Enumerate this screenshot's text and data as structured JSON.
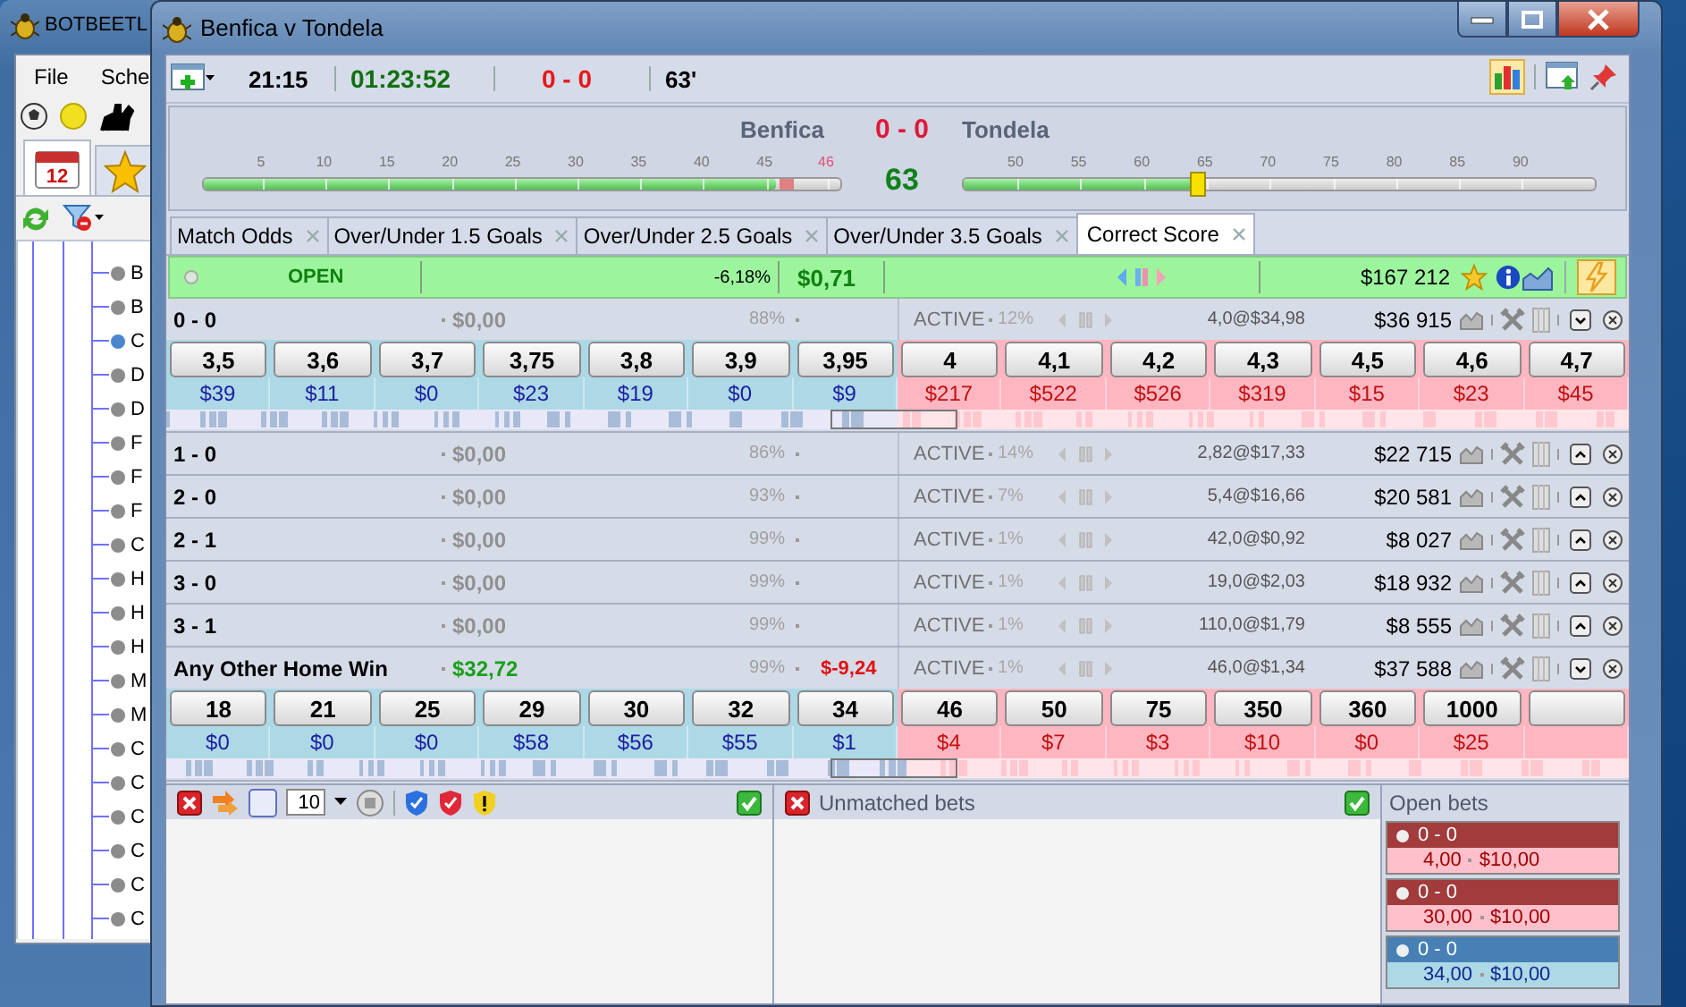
{
  "background_window": {
    "title": "BOTBEETL",
    "menu": [
      "File",
      "Sche"
    ],
    "calendar_day": "12",
    "tabs": [
      {
        "kind": "calendar",
        "selected": true
      },
      {
        "kind": "favorites",
        "selected": false
      }
    ],
    "tree_items": [
      {
        "label": "B",
        "color": "#8c8c8c"
      },
      {
        "label": "B",
        "color": "#8c8c8c"
      },
      {
        "label": "C",
        "color": "#4a86d0"
      },
      {
        "label": "D",
        "color": "#8c8c8c"
      },
      {
        "label": "D",
        "color": "#8c8c8c"
      },
      {
        "label": "F",
        "color": "#8c8c8c"
      },
      {
        "label": "F",
        "color": "#8c8c8c"
      },
      {
        "label": "F",
        "color": "#8c8c8c"
      },
      {
        "label": "C",
        "color": "#8c8c8c"
      },
      {
        "label": "H",
        "color": "#8c8c8c"
      },
      {
        "label": "H",
        "color": "#8c8c8c"
      },
      {
        "label": "H",
        "color": "#8c8c8c"
      },
      {
        "label": "M",
        "color": "#8c8c8c"
      },
      {
        "label": "M",
        "color": "#8c8c8c"
      },
      {
        "label": "C",
        "color": "#8c8c8c"
      },
      {
        "label": "C",
        "color": "#8c8c8c"
      },
      {
        "label": "C",
        "color": "#8c8c8c"
      },
      {
        "label": "C",
        "color": "#8c8c8c"
      },
      {
        "label": "C",
        "color": "#8c8c8c"
      },
      {
        "label": "C",
        "color": "#8c8c8c"
      }
    ]
  },
  "window": {
    "title": "Benfica v Tondela"
  },
  "toolbar": {
    "start_time": "21:15",
    "elapsed": "01:23:52",
    "score": "0 - 0",
    "minute": "63'",
    "chart_view_on": true
  },
  "match": {
    "home": "Benfica",
    "score": "0 - 0",
    "away": "Tondela",
    "minute": "63",
    "first_half": {
      "level": 0.9,
      "ticks": [
        {
          "label": "5",
          "current": false
        },
        {
          "label": "10",
          "current": false
        },
        {
          "label": "15",
          "current": false
        },
        {
          "label": "20",
          "current": false
        },
        {
          "label": "25",
          "current": false
        },
        {
          "label": "30",
          "current": false
        },
        {
          "label": "35",
          "current": false
        },
        {
          "label": "40",
          "current": false
        },
        {
          "label": "45",
          "current": false
        },
        {
          "label": "46",
          "current": true
        }
      ]
    },
    "second_half": {
      "level": 0.37,
      "ticks": [
        {
          "label": "50",
          "current": false
        },
        {
          "label": "55",
          "current": false
        },
        {
          "label": "60",
          "current": false
        },
        {
          "label": "65",
          "current": false
        },
        {
          "label": "70",
          "current": false
        },
        {
          "label": "75",
          "current": false
        },
        {
          "label": "80",
          "current": false
        },
        {
          "label": "85",
          "current": false
        },
        {
          "label": "90",
          "current": false
        }
      ]
    }
  },
  "market_tabs": [
    {
      "label": "Match Odds",
      "selected": false
    },
    {
      "label": "Over/Under 1.5 Goals",
      "selected": false
    },
    {
      "label": "Over/Under 2.5 Goals",
      "selected": false
    },
    {
      "label": "Over/Under 3.5 Goals",
      "selected": false
    },
    {
      "label": "Correct Score",
      "selected": true
    }
  ],
  "market": {
    "status": "OPEN",
    "overround": "-6,18%",
    "pl": "$0,71",
    "matched": "$167 212"
  },
  "runners": [
    {
      "name": "0 - 0",
      "pl": "$0,00",
      "in_profit": false,
      "pct": "88%",
      "status": "ACTIVE",
      "pct2": "12%",
      "last": "4,0@$34,98",
      "volume": "$36 915",
      "expanded": true,
      "back": [
        {
          "price": "3,5",
          "amount": "$39"
        },
        {
          "price": "3,6",
          "amount": "$11"
        },
        {
          "price": "3,7",
          "amount": "$0"
        },
        {
          "price": "3,75",
          "amount": "$23"
        },
        {
          "price": "3,8",
          "amount": "$19"
        },
        {
          "price": "3,9",
          "amount": "$0"
        },
        {
          "price": "3,95",
          "amount": "$9"
        }
      ],
      "lay": [
        {
          "price": "4",
          "amount": "$217"
        },
        {
          "price": "4,1",
          "amount": "$522"
        },
        {
          "price": "4,2",
          "amount": "$526"
        },
        {
          "price": "4,3",
          "amount": "$319"
        },
        {
          "price": "4,5",
          "amount": "$15"
        },
        {
          "price": "4,6",
          "amount": "$23"
        },
        {
          "price": "4,7",
          "amount": "$45"
        }
      ]
    },
    {
      "name": "1 - 0",
      "pl": "$0,00",
      "in_profit": false,
      "pct": "86%",
      "status": "ACTIVE",
      "pct2": "14%",
      "last": "2,82@$17,33",
      "volume": "$22 715",
      "expanded": false
    },
    {
      "name": "2 - 0",
      "pl": "$0,00",
      "in_profit": false,
      "pct": "93%",
      "status": "ACTIVE",
      "pct2": "7%",
      "last": "5,4@$16,66",
      "volume": "$20 581",
      "expanded": false
    },
    {
      "name": "2 - 1",
      "pl": "$0,00",
      "in_profit": false,
      "pct": "99%",
      "status": "ACTIVE",
      "pct2": "1%",
      "last": "42,0@$0,92",
      "volume": "$8 027",
      "expanded": false
    },
    {
      "name": "3 - 0",
      "pl": "$0,00",
      "in_profit": false,
      "pct": "99%",
      "status": "ACTIVE",
      "pct2": "1%",
      "last": "19,0@$2,03",
      "volume": "$18 932",
      "expanded": false
    },
    {
      "name": "3 - 1",
      "pl": "$0,00",
      "in_profit": false,
      "pct": "99%",
      "status": "ACTIVE",
      "pct2": "1%",
      "last": "110,0@$1,79",
      "volume": "$8 555",
      "expanded": false
    },
    {
      "name": "Any Other Home Win",
      "pl": "$32,72",
      "in_profit": true,
      "pct": "99%",
      "loss": "$-9,24",
      "status": "ACTIVE",
      "pct2": "1%",
      "last": "46,0@$1,34",
      "volume": "$37 588",
      "expanded": true,
      "back": [
        {
          "price": "18",
          "amount": "$0"
        },
        {
          "price": "21",
          "amount": "$0"
        },
        {
          "price": "25",
          "amount": "$0"
        },
        {
          "price": "29",
          "amount": "$58"
        },
        {
          "price": "30",
          "amount": "$56"
        },
        {
          "price": "32",
          "amount": "$55"
        },
        {
          "price": "34",
          "amount": "$1"
        }
      ],
      "lay": [
        {
          "price": "46",
          "amount": "$4"
        },
        {
          "price": "50",
          "amount": "$7"
        },
        {
          "price": "75",
          "amount": "$3"
        },
        {
          "price": "350",
          "amount": "$10"
        },
        {
          "price": "360",
          "amount": "$0"
        },
        {
          "price": "1000",
          "amount": "$25"
        }
      ]
    }
  ],
  "bottom": {
    "stake": "10",
    "unmatched_title": "Unmatched bets",
    "open_bets_title": "Open bets",
    "open_bets": [
      {
        "selection": "0 - 0",
        "odds": "4,00",
        "stake": "$10,00",
        "kind": "lay"
      },
      {
        "selection": "0 - 0",
        "odds": "30,00",
        "stake": "$10,00",
        "kind": "lay"
      },
      {
        "selection": "0 - 0",
        "odds": "34,00",
        "stake": "$10,00",
        "kind": "back"
      }
    ]
  }
}
